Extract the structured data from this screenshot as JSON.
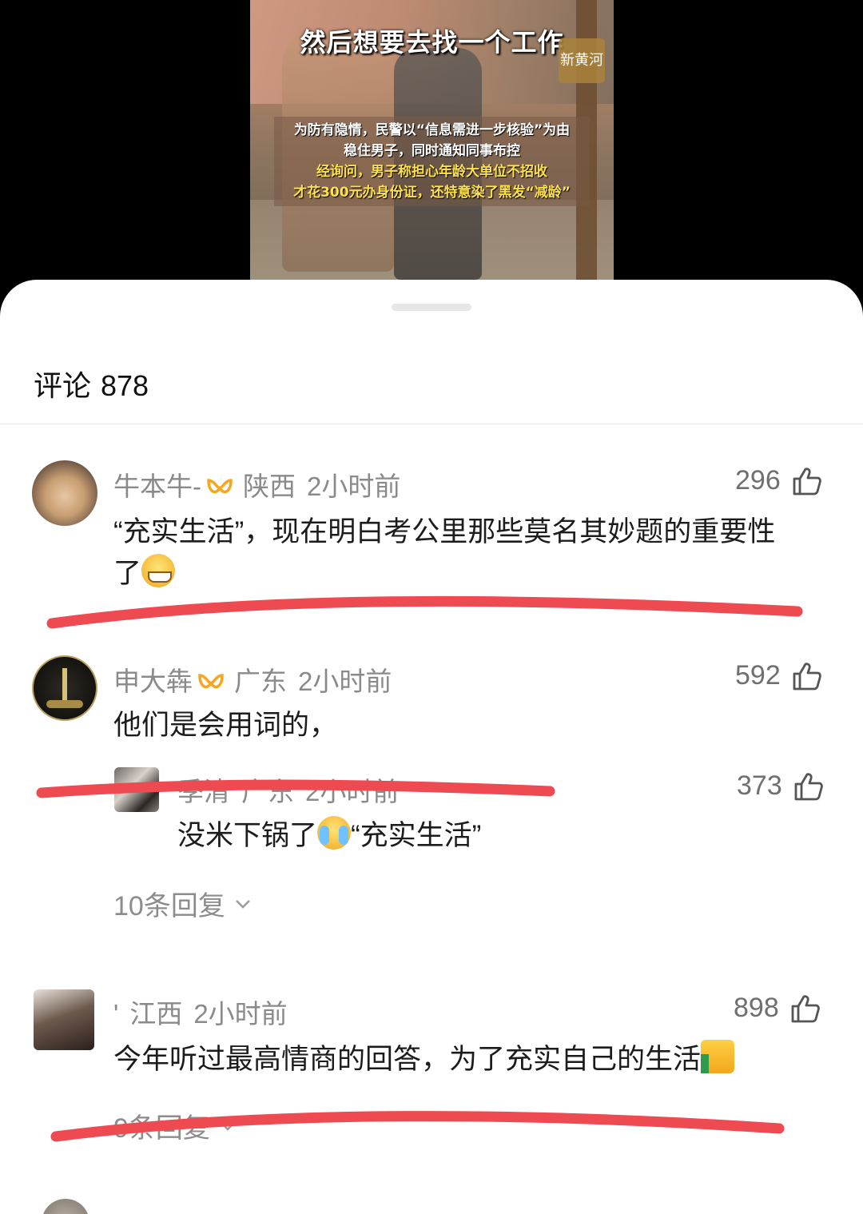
{
  "video": {
    "title": "然后想要去找一个工作",
    "logo_text": "新黄河",
    "captions": [
      {
        "text": "为防有隐情，民警以“信息需进一步核验”为由",
        "color": "white"
      },
      {
        "text": "稳住男子，同时通知同事布控",
        "color": "white"
      },
      {
        "text": "经询问，男子称担心年龄大单位不招收",
        "color": "yellow"
      },
      {
        "text": "才花300元办身份证，还特意染了黑发“减龄”",
        "color": "yellow"
      }
    ]
  },
  "comments_header": {
    "label": "评论",
    "count": "878"
  },
  "comments": [
    {
      "username": "牛本牛-",
      "location": "陕西",
      "time": "2小时前",
      "likes": "296",
      "text_line1": "“充实生活”，现在明白考公里那些莫名其妙题的重要性",
      "text_line2": "了",
      "emoji": "grinning-face"
    },
    {
      "username": "申大犇",
      "location": "广东",
      "time": "2小时前",
      "likes": "592",
      "text": "他们是会用词的，",
      "reply": {
        "username": "季清",
        "location": "广东",
        "time": "2小时前",
        "likes": "373",
        "text_before": "没米下锅了",
        "emoji": "crying-face",
        "text_after": "“充实生活”"
      },
      "replies_toggle": "10条回复"
    },
    {
      "username": "'",
      "location": "江西",
      "time": "2小时前",
      "likes": "898",
      "text": "今年听过最高情商的回答，为了充实自己的生活",
      "emoji": "thumbs-up",
      "replies_toggle": "9条回复"
    }
  ],
  "colors": {
    "annotation_red": "#ee4a52",
    "vip_badge": "#f5a623",
    "meta_gray": "#8a8a8a",
    "caption_yellow": "#ffe24a"
  },
  "icons": [
    "like-icon",
    "chevron-down-icon",
    "vip-badge-icon"
  ]
}
